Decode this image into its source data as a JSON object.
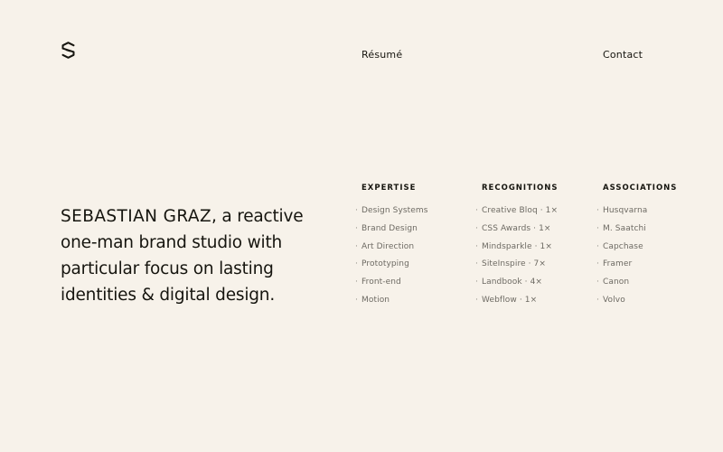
{
  "nav": {
    "logo_icon": "brand-s-logo-icon",
    "resume_label": "Résumé",
    "contact_label": "Contact"
  },
  "intro": {
    "name": "SEBASTIAN GRAZ",
    "text": ", a reactive one-man brand studio with particular focus on lasting identities & digital design."
  },
  "columns": {
    "expertise": {
      "heading": "EXPERTISE",
      "items": [
        "Design Systems",
        "Brand Design",
        "Art Direction",
        "Prototyping",
        "Front-end",
        "Motion"
      ]
    },
    "recognitions": {
      "heading": "RECOGNITIONS",
      "items": [
        "Creative Bloq · 1×",
        "CSS Awards · 1×",
        "Mindsparkle · 1×",
        "SiteInspire · 7×",
        "Landbook · 4×",
        "Webflow · 1×"
      ]
    },
    "associations": {
      "heading": "ASSOCIATIONS",
      "items": [
        "Husqvarna",
        "M. Saatchi",
        "Capchase",
        "Framer",
        "Canon",
        "Volvo"
      ]
    }
  },
  "bullet_glyph": "·",
  "colors": {
    "background": "#f7f2ea",
    "text": "#16150f",
    "muted": "#6d6a63"
  }
}
